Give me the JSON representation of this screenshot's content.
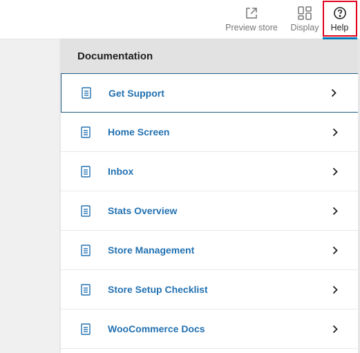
{
  "topbar": {
    "preview_store": {
      "label": "Preview store",
      "icon": "external-link-icon"
    },
    "display": {
      "label": "Display",
      "icon": "layout-icon"
    },
    "help": {
      "label": "Help",
      "icon": "help-circle-icon"
    }
  },
  "colors": {
    "accent": "#2271b1",
    "help_highlight": "#e0001b",
    "active_underline": "#007cba"
  },
  "panel": {
    "title": "Documentation",
    "items": [
      {
        "label": "Get Support",
        "icon": "document-icon"
      },
      {
        "label": "Home Screen",
        "icon": "document-icon"
      },
      {
        "label": "Inbox",
        "icon": "document-icon"
      },
      {
        "label": "Stats Overview",
        "icon": "document-icon"
      },
      {
        "label": "Store Management",
        "icon": "document-icon"
      },
      {
        "label": "Store Setup Checklist",
        "icon": "document-icon"
      },
      {
        "label": "WooCommerce Docs",
        "icon": "document-icon"
      }
    ]
  }
}
